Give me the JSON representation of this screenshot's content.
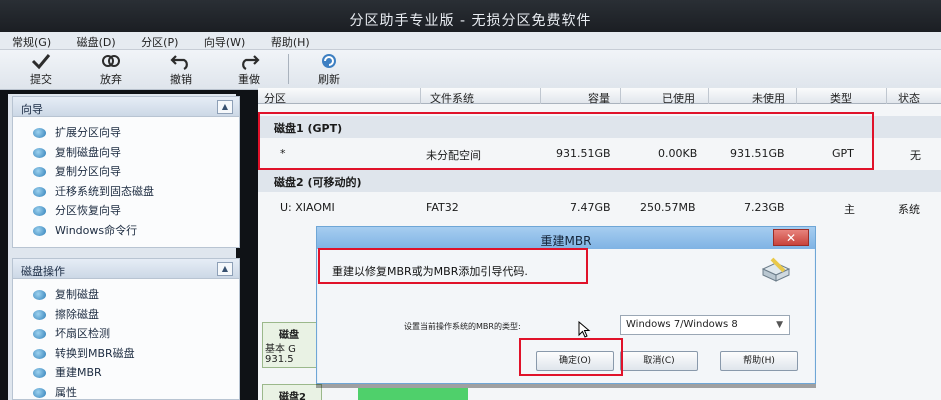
{
  "window": {
    "title": "分区助手专业版 - 无损分区免费软件"
  },
  "menu": [
    "常规(G)",
    "磁盘(D)",
    "分区(P)",
    "向导(W)",
    "帮助(H)"
  ],
  "toolbar": {
    "commit": "提交",
    "discard": "放弃",
    "undo": "撤销",
    "redo": "重做",
    "refresh": "刷新"
  },
  "wizard": {
    "title": "向导",
    "items": [
      "扩展分区向导",
      "复制磁盘向导",
      "复制分区向导",
      "迁移系统到固态磁盘",
      "分区恢复向导",
      "Windows命令行"
    ]
  },
  "disk_ops": {
    "title": "磁盘操作",
    "items": [
      "复制磁盘",
      "擦除磁盘",
      "坏扇区检测",
      "转换到MBR磁盘",
      "重建MBR",
      "属性"
    ]
  },
  "table": {
    "columns": [
      "分区",
      "文件系统",
      "容量",
      "已使用",
      "未使用",
      "类型",
      "状态"
    ],
    "disk1": {
      "header": "磁盘1 (GPT)",
      "row": [
        "*",
        "未分配空间",
        "931.51GB",
        "0.00KB",
        "931.51GB",
        "GPT",
        "无"
      ]
    },
    "disk2": {
      "header": "磁盘2 (可移动的)",
      "row": [
        "U: XIAOMI",
        "FAT32",
        "7.47GB",
        "250.57MB",
        "7.23GB",
        "主",
        "系统"
      ]
    }
  },
  "disk_cards": {
    "card1": {
      "name": "磁盘",
      "l2": "基本 G",
      "l3": "931.5"
    },
    "card2": {
      "name": "磁盘2"
    }
  },
  "dialog": {
    "title": "重建MBR",
    "close": "✕",
    "message": "重建以修复MBR或为MBR添加引导代码.",
    "select_label": "设置当前操作系统的MBR的类型:",
    "select_value": "Windows 7/Windows 8",
    "ok": "确定(O)",
    "cancel": "取消(C)",
    "help": "帮助(H)"
  },
  "colors": {
    "highlight": "#e0122a",
    "dialog_title": "#7fb3e4"
  }
}
